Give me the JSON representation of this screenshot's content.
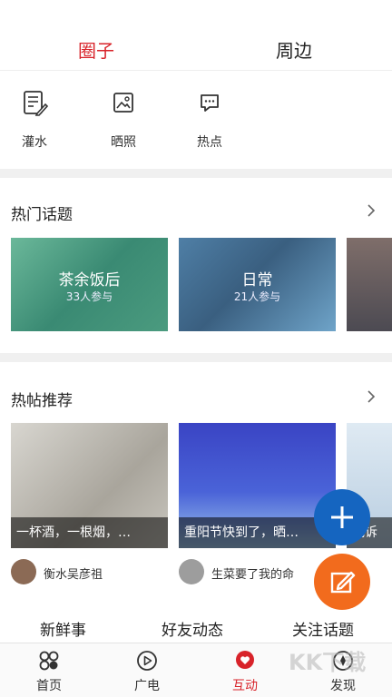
{
  "top_tabs": {
    "circle": "圈子",
    "nearby": "周边"
  },
  "quick_actions": [
    {
      "label": "灌水",
      "icon": "note-edit-icon"
    },
    {
      "label": "晒照",
      "icon": "image-icon"
    },
    {
      "label": "热点",
      "icon": "chat-bubble-icon"
    }
  ],
  "hot_topics": {
    "title": "热门话题",
    "items": [
      {
        "title": "茶余饭后",
        "count": "33人参与"
      },
      {
        "title": "日常",
        "count": "21人参与"
      }
    ]
  },
  "hot_posts": {
    "title": "热帖推荐",
    "items": [
      {
        "caption": "一杯酒，一根烟，…",
        "author": "衡水吴彦祖"
      },
      {
        "caption": "重阳节快到了，晒…",
        "author": "生菜要了我的命"
      },
      {
        "caption": "我诉"
      }
    ]
  },
  "feed_tabs": {
    "fresh": "新鲜事",
    "friends": "好友动态",
    "following": "关注话题"
  },
  "bottom_nav": {
    "home": "首页",
    "broadcast": "广电",
    "interact": "互动",
    "discover": "发现"
  },
  "watermark": "KK下载",
  "colors": {
    "accent": "#d8232a",
    "fab_blue": "#1565c0",
    "fab_orange": "#f26b1d"
  }
}
